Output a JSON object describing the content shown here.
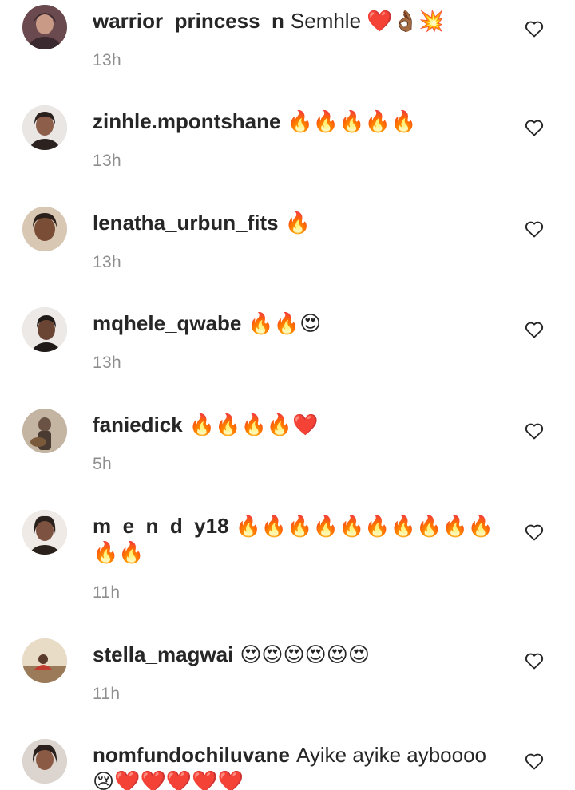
{
  "comments": [
    {
      "username": "warrior_princess_n",
      "text": "Semhle ❤️👌🏾💥",
      "time": "13h",
      "avatar_colors": [
        "#6b4a4f",
        "#3a2a2f",
        "#c99a86"
      ]
    },
    {
      "username": "zinhle.mpontshane",
      "text": "🔥🔥🔥🔥🔥",
      "time": "13h",
      "avatar_colors": [
        "#e9e6e4",
        "#2b2220",
        "#8d5f4b"
      ]
    },
    {
      "username": "lenatha_urbun_fits",
      "text": "🔥",
      "time": "13h",
      "avatar_colors": [
        "#d8c7b2",
        "#2a1f1a",
        "#7a4d36"
      ]
    },
    {
      "username": "mqhele_qwabe",
      "text": "🔥🔥😍",
      "time": "13h",
      "avatar_colors": [
        "#ece9e6",
        "#1f1917",
        "#6b4534"
      ]
    },
    {
      "username": "faniedick",
      "text": "🔥🔥🔥🔥❤️",
      "time": "5h",
      "avatar_colors": [
        "#c4b5a3",
        "#4a3b32",
        "#6a5244"
      ]
    },
    {
      "username": "m_e_n_d_y18",
      "text": "🔥🔥🔥🔥🔥🔥🔥🔥🔥🔥🔥🔥",
      "time": "11h",
      "avatar_colors": [
        "#efeae6",
        "#2a201c",
        "#7d5240"
      ]
    },
    {
      "username": "stella_magwai",
      "text": "😍😍😍😍😍😍",
      "time": "11h",
      "avatar_colors": [
        "#e9dcc7",
        "#c23b2f",
        "#9a7a58"
      ]
    },
    {
      "username": "nomfundochiluvane",
      "text": "Ayike ayike ayboooo 😢❤️❤️❤️❤️❤️",
      "time": "",
      "avatar_colors": [
        "#dcd5cf",
        "#2b201c",
        "#8a5a44"
      ]
    }
  ],
  "colors": {
    "username": "#262626",
    "time": "#8e8e8e",
    "like_icon": "#262626"
  }
}
